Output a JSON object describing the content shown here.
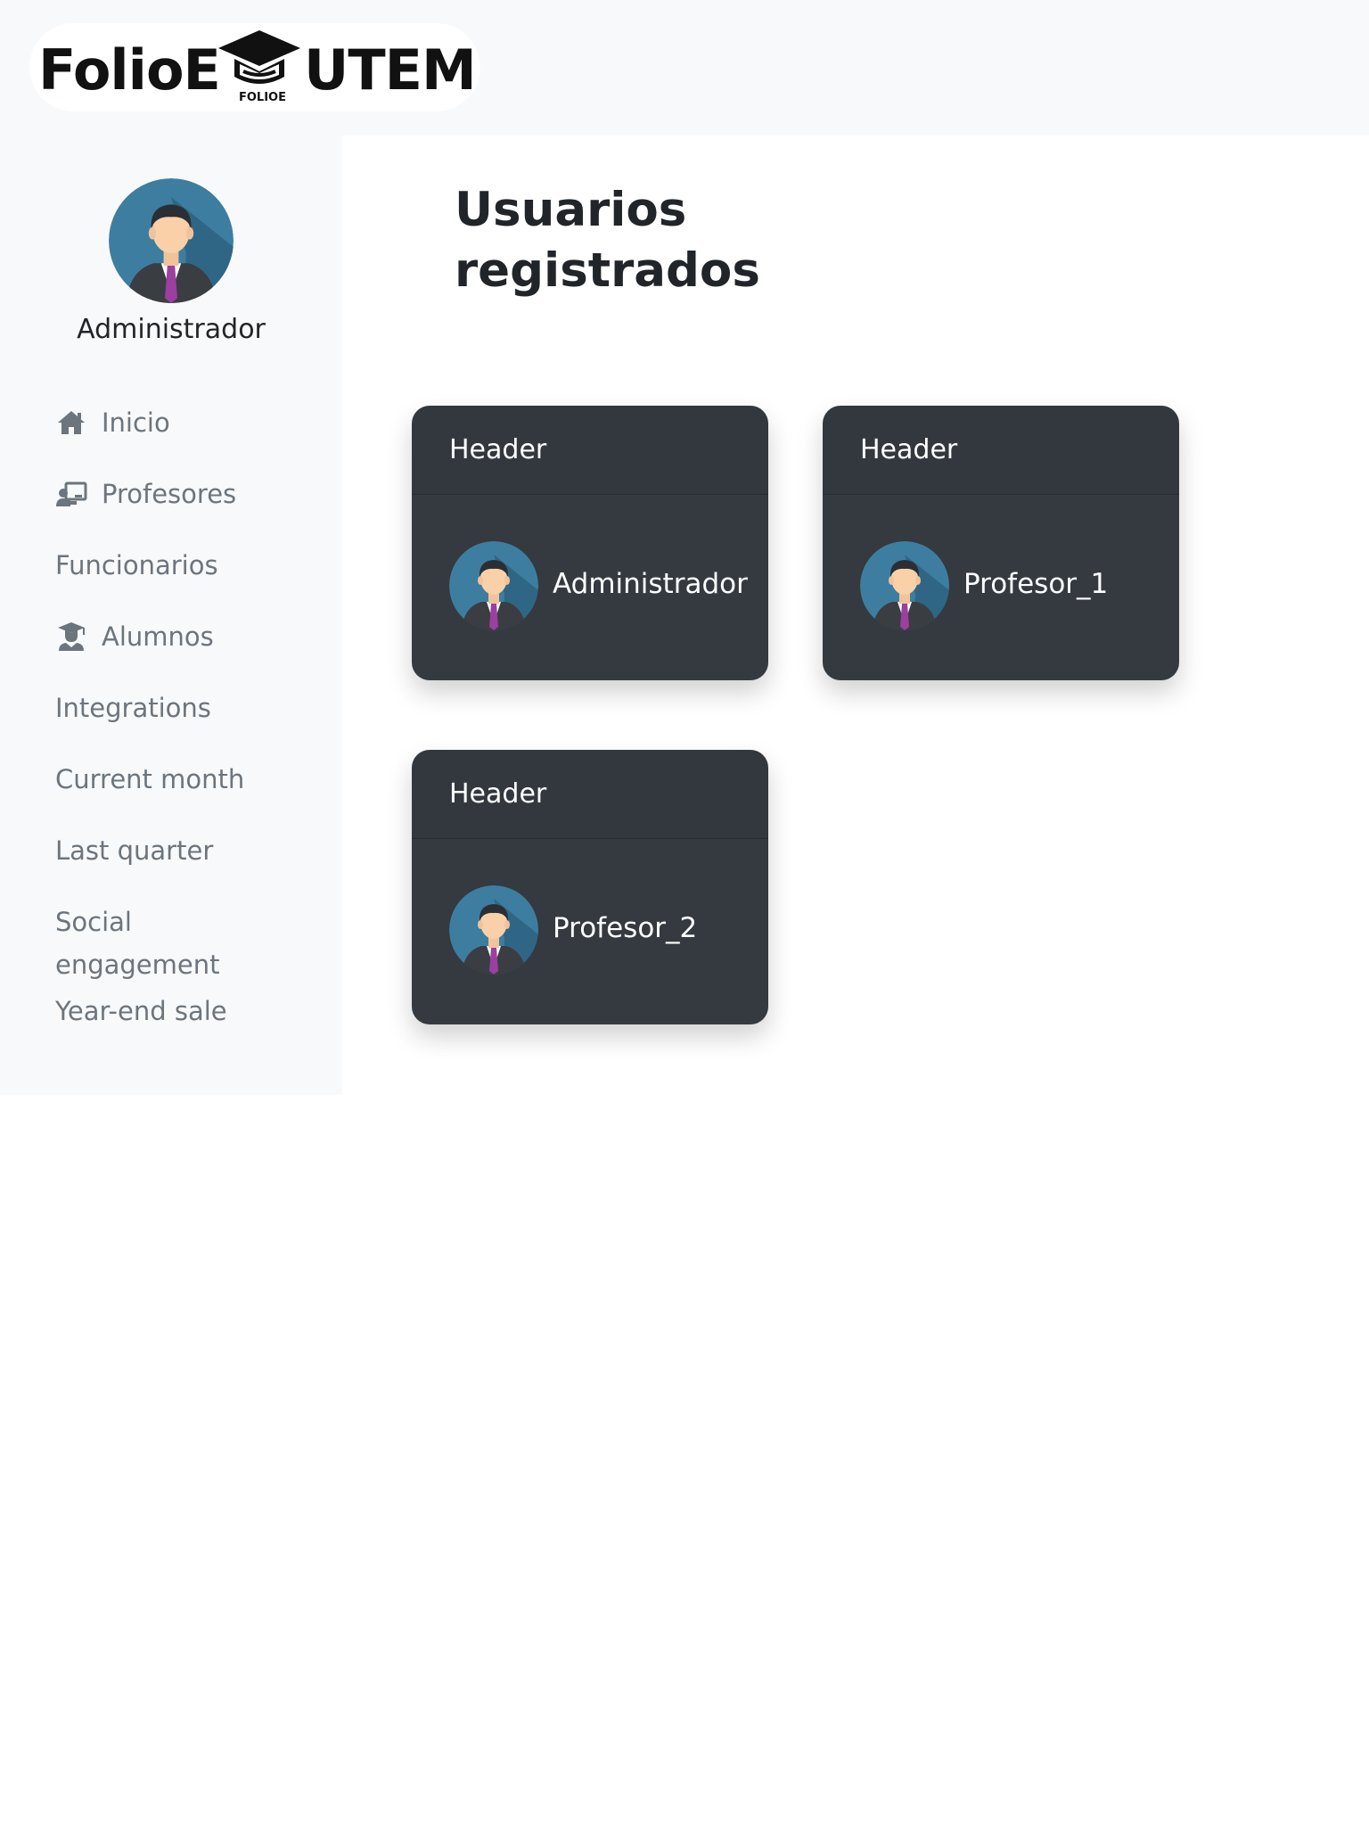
{
  "logo": {
    "brand_left": "FolioE",
    "brand_right": "UTEM",
    "brand_small": "FOLIOE",
    "icon": "graduation-cap-icon"
  },
  "sidebar": {
    "user_name": "Administrador",
    "items": [
      {
        "label": "Inicio",
        "icon": "home-icon"
      },
      {
        "label": "Profesores",
        "icon": "chalkboard-teacher-icon"
      },
      {
        "label": "Funcionarios"
      },
      {
        "label": "Alumnos",
        "icon": "user-graduate-icon"
      },
      {
        "label": "Integrations"
      },
      {
        "label": "Current month"
      },
      {
        "label": "Last quarter"
      },
      {
        "label": "Social engagement"
      },
      {
        "label": "Year-end sale"
      }
    ]
  },
  "main": {
    "title": "Usuarios registrados",
    "cards": [
      {
        "header": "Header",
        "name": "Administrador"
      },
      {
        "header": "Header",
        "name": "Profesor_1"
      },
      {
        "header": "Header",
        "name": "Profesor_2"
      }
    ]
  },
  "colors": {
    "sidebar_bg": "#f8f9fa",
    "card_bg": "#343a40",
    "nav_text": "#6c757d",
    "avatar_bg": "#3d7ea0",
    "tie": "#9b3fa0"
  }
}
